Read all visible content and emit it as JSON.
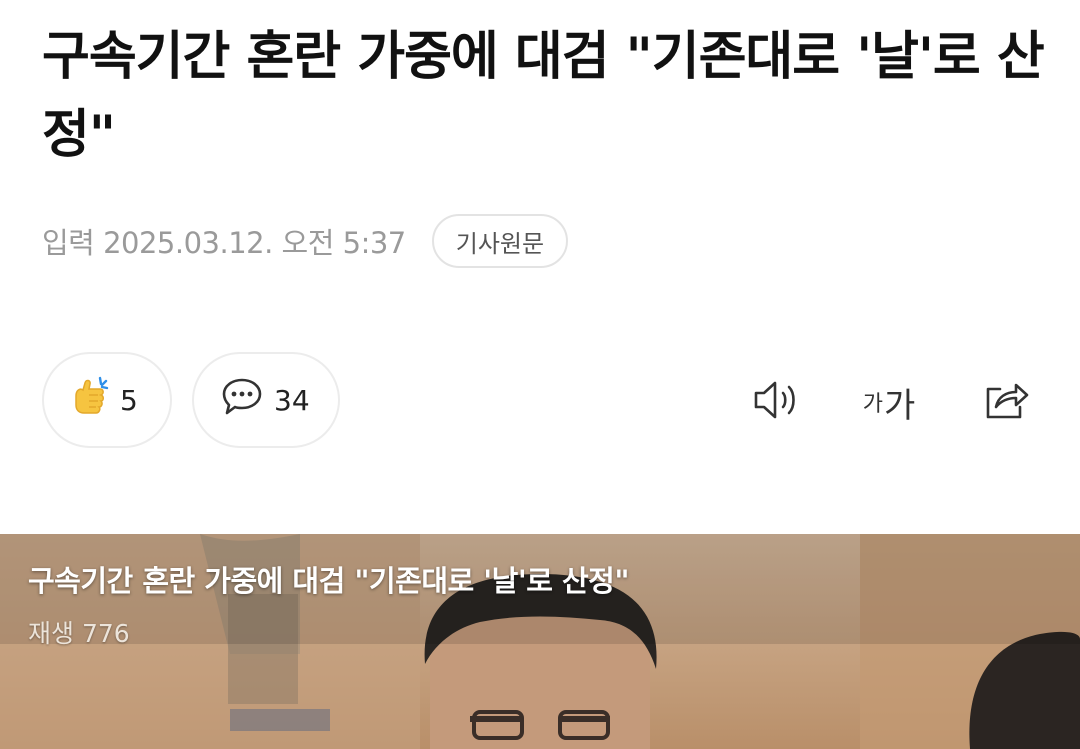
{
  "article": {
    "title": "구속기간 혼란 가중에 대검 \"기존대로 '날'로 산정\"",
    "date_text": "입력 2025.03.12. 오전 5:37",
    "source_button": "기사원문"
  },
  "reactions": {
    "like_icon": "clap-hand-icon",
    "like_count": "5",
    "comment_icon": "speech-bubble-icon",
    "comment_count": "34"
  },
  "toolbar": {
    "sound_icon": "speaker-icon",
    "font_small": "가",
    "font_large": "가",
    "share_icon": "share-icon"
  },
  "video": {
    "title": "구속기간 혼란 가중에 대검 \"기존대로 '날'로 산정\"",
    "views": "재생 776"
  },
  "colors": {
    "text": "#111111",
    "meta_text": "#9a9a9a",
    "border": "#e3e3e3",
    "like_icon": "#f6c440",
    "like_spark": "#2f8fe8",
    "video_bg": "#c7a380"
  }
}
